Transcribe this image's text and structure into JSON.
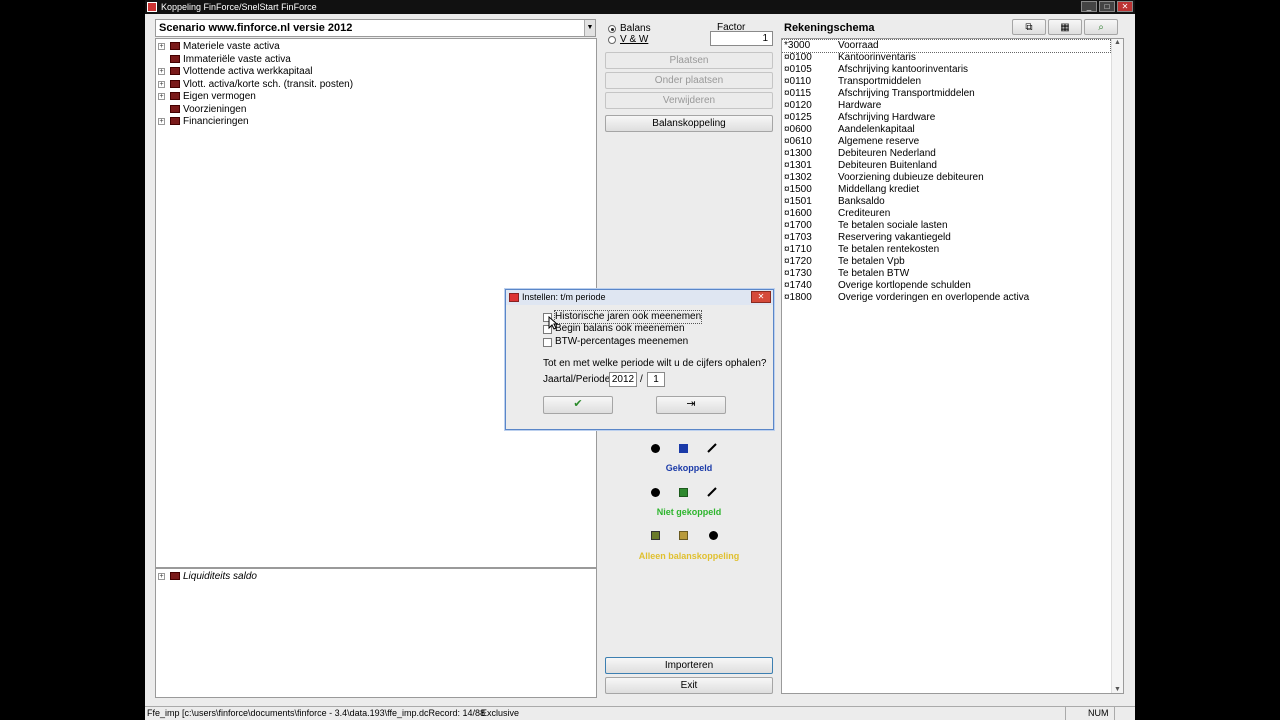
{
  "window": {
    "title": "Koppeling FinForce/SnelStart  FinForce",
    "controls": [
      "_",
      "□",
      "✕"
    ]
  },
  "scenario": {
    "label": "Scenario www.finforce.nl versie 2012"
  },
  "tree": {
    "items": [
      "Materiele vaste activa",
      "Immateriële vaste activa",
      "Vlottende activa werkkapitaal",
      "Vlott. activa/korte sch. (transit. posten)",
      "Eigen vermogen",
      "Voorzieningen",
      "Financieringen"
    ],
    "bottom_item": "Liquiditeits saldo"
  },
  "mode": {
    "options": [
      "Balans",
      "V & W"
    ],
    "selected": "Balans"
  },
  "factor": {
    "label": "Factor",
    "value": "1"
  },
  "actions": {
    "plaatsen": "Plaatsen",
    "onder_plaatsen": "Onder plaatsen",
    "verwijderen": "Verwijderen",
    "balanskoppeling": "Balanskoppeling",
    "importeren": "Importeren",
    "exit": "Exit"
  },
  "legend": {
    "gekoppeld": "Gekoppeld",
    "niet_gekoppeld": "Niet gekoppeld",
    "alleen_balanskoppeling": "Alleen balanskoppeling",
    "colors": {
      "gekoppeld": "#1a3aa8",
      "niet_gekoppeld": "#2db52d",
      "alleen_balanskoppeling": "#e0c030"
    }
  },
  "accounts": {
    "title": "Rekeningschema",
    "rows": [
      {
        "code": "*3000",
        "name": "Voorraad"
      },
      {
        "code": "¤0100",
        "name": "Kantoorinventaris"
      },
      {
        "code": "¤0105",
        "name": "Afschrijving kantoorinventaris"
      },
      {
        "code": "¤0110",
        "name": "Transportmiddelen"
      },
      {
        "code": "¤0115",
        "name": "Afschrijving Transportmiddelen"
      },
      {
        "code": "¤0120",
        "name": "Hardware"
      },
      {
        "code": "¤0125",
        "name": "Afschrijving Hardware"
      },
      {
        "code": "¤0600",
        "name": "Aandelenkapitaal"
      },
      {
        "code": "¤0610",
        "name": "Algemene reserve"
      },
      {
        "code": "¤1300",
        "name": "Debiteuren Nederland"
      },
      {
        "code": "¤1301",
        "name": "Debiteuren Buitenland"
      },
      {
        "code": "¤1302",
        "name": "Voorziening dubieuze debiteuren"
      },
      {
        "code": "¤1500",
        "name": "Middellang krediet"
      },
      {
        "code": "¤1501",
        "name": "Banksaldo"
      },
      {
        "code": "¤1600",
        "name": "Crediteuren"
      },
      {
        "code": "¤1700",
        "name": "Te betalen sociale lasten"
      },
      {
        "code": "¤1703",
        "name": "Reservering vakantiegeld"
      },
      {
        "code": "¤1710",
        "name": "Te betalen rentekosten"
      },
      {
        "code": "¤1720",
        "name": "Te betalen Vpb"
      },
      {
        "code": "¤1730",
        "name": "Te betalen BTW"
      },
      {
        "code": "¤1740",
        "name": "Overige kortlopende schulden"
      },
      {
        "code": "¤1800",
        "name": "Overige vorderingen en overlopende activa"
      }
    ]
  },
  "dialog": {
    "title": "Instellen: t/m periode",
    "close": "✕",
    "checkboxes": [
      "Historische jaren ook meenemen",
      "Begin balans ook meenemen",
      "BTW-percentages meenemen"
    ],
    "question": "Tot en met welke periode wilt u de cijfers ophalen?",
    "period_label": "Jaartal/Periode",
    "year": "2012",
    "separator": "/",
    "period": "1",
    "ok_symbol": "✔",
    "exit_symbol": "⇥"
  },
  "statusbar": {
    "path": "Ffe_imp [c:\\users\\finforce\\documents\\finforce - 3.4\\data.193\\ffe_imp.dcRecord: 14/88",
    "mode": "Exclusive",
    "num": "NUM"
  }
}
